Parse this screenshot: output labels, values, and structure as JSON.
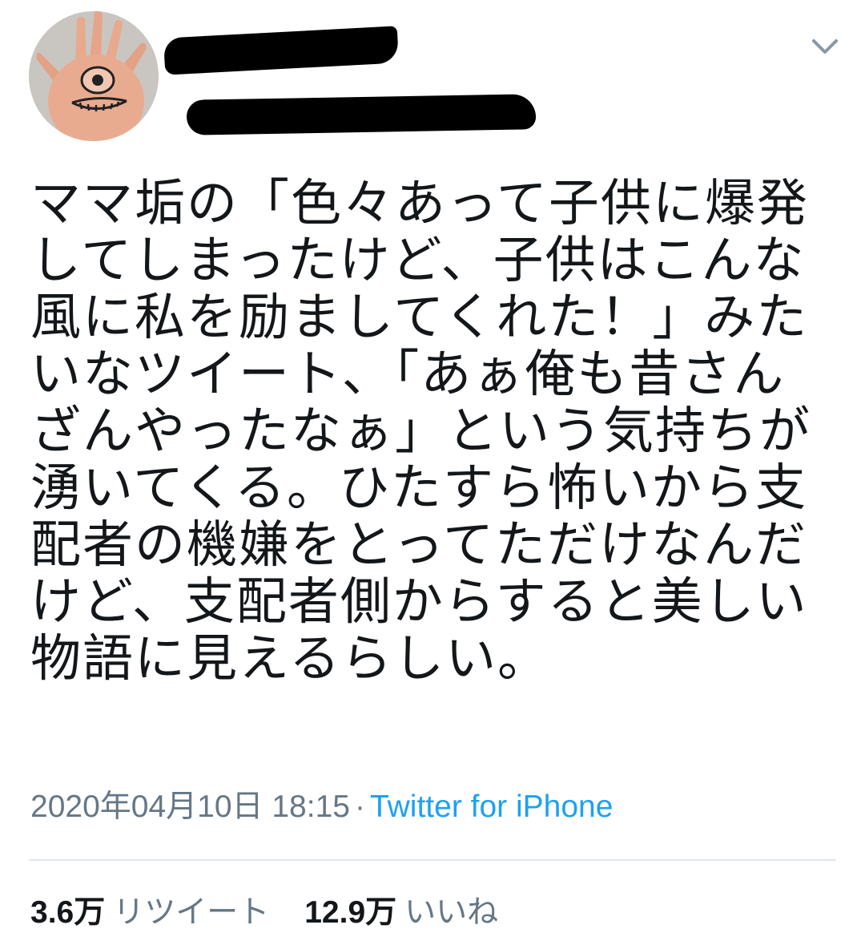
{
  "tweet": {
    "text": "ママ垢の「色々あって子供に爆発\nしてしまったけど、子供はこんな\n風に私を励ましてくれた！」みた\nいなツイート、「あぁ俺も昔さん\nざんやったなぁ」という気持ちが\n湧いてくる。ひたすら怖いから支\n配者の機嫌をとってただけなんだ\nけど、支配者側からすると美しい\n物語に見えるらしい。",
    "timestamp": "2020年04月10日 18:15",
    "separator": "·",
    "source": "Twitter for iPhone"
  },
  "stats": {
    "retweets_count": "3.6万",
    "retweets_label": "リツイート",
    "likes_count": "12.9万",
    "likes_label": "いいね"
  },
  "colors": {
    "text": "#14171a",
    "secondary": "#657786",
    "link": "#1da1f2",
    "divider": "#e1e8ed",
    "redaction": "#000000"
  },
  "icons": {
    "more": "chevron-down-icon",
    "avatar": "hand-eye-drawing"
  }
}
